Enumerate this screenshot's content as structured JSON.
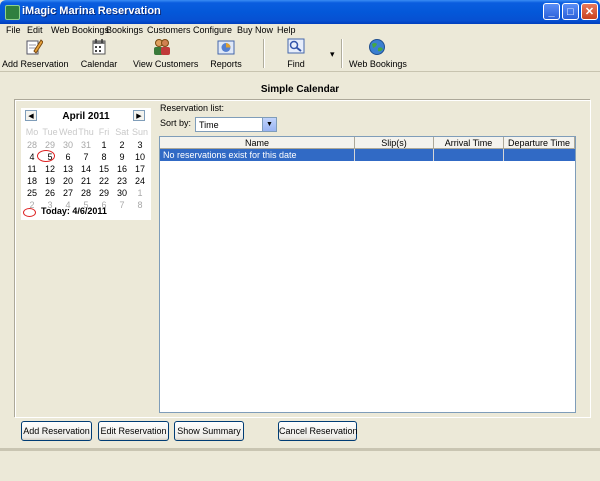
{
  "window": {
    "title": "iMagic Marina Reservation",
    "minimize_glyph": "_",
    "maximize_glyph": "□",
    "close_glyph": "✕"
  },
  "menu": [
    "File",
    "Edit",
    "Web Bookings",
    "Bookings",
    "Customers",
    "Configure",
    "Buy Now",
    "Help"
  ],
  "toolbar": {
    "add_reservation": "Add Reservation",
    "calendar": "Calendar",
    "view_customers": "View Customers",
    "reports": "Reports",
    "find": "Find",
    "find_dropdown": "▾",
    "web_bookings": "Web Bookings"
  },
  "page": {
    "title": "Simple Calendar"
  },
  "calendar": {
    "month": "April 2011",
    "prev": "◀",
    "next": "▶",
    "days_of_week": [
      "Mo",
      "Tue",
      "Wed",
      "Thu",
      "Fri",
      "Sat",
      "Sun"
    ],
    "weeks": [
      [
        "28",
        "29",
        "30",
        "31",
        "1",
        "2",
        "3"
      ],
      [
        "4",
        "5",
        "6",
        "7",
        "8",
        "9",
        "10"
      ],
      [
        "11",
        "12",
        "13",
        "14",
        "15",
        "16",
        "17"
      ],
      [
        "18",
        "19",
        "20",
        "21",
        "22",
        "23",
        "24"
      ],
      [
        "25",
        "26",
        "27",
        "28",
        "29",
        "30",
        "1"
      ],
      [
        "2",
        "3",
        "4",
        "5",
        "6",
        "7",
        "8"
      ]
    ],
    "today_label": "Today: 4/6/2011"
  },
  "reservations": {
    "list_label": "Reservation list:",
    "sort_label": "Sort by:",
    "sort_value": "Time",
    "columns": [
      "Name",
      "Slip(s)",
      "Arrival Time",
      "Departure Time"
    ],
    "empty_message": "No reservations exist for this date"
  },
  "buttons": {
    "add_reservation": "Add Reservation",
    "edit_reservation": "Edit Reservation",
    "show_summary": "Show Summary",
    "cancel_reservation": "Cancel Reservation"
  },
  "colors": {
    "titlebar": "#0458d9",
    "selection": "#316ac5",
    "today_marker": "#dd2222",
    "background": "#ece9d8"
  }
}
